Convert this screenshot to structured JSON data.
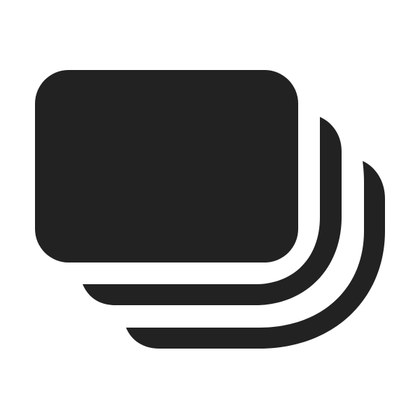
{
  "icon": {
    "name": "stacked-cards-icon",
    "color": "#222222",
    "background": "#ffffff"
  }
}
